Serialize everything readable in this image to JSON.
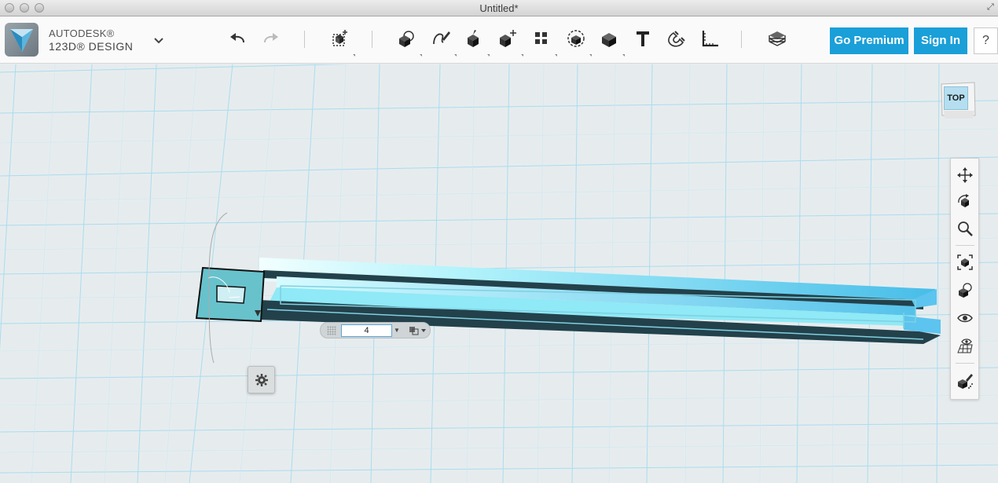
{
  "window": {
    "title": "Untitled*"
  },
  "brand": {
    "line1": "AUTODESK®",
    "line2": "123D® DESIGN"
  },
  "toolbar": {
    "buttons": [
      {
        "name": "undo-icon"
      },
      {
        "name": "redo-icon"
      },
      {
        "name": "transform-icon"
      },
      {
        "name": "primitives-icon"
      },
      {
        "name": "sketch-icon"
      },
      {
        "name": "construct-icon"
      },
      {
        "name": "modify-icon"
      },
      {
        "name": "pattern-icon"
      },
      {
        "name": "grouping-icon"
      },
      {
        "name": "combine-icon"
      },
      {
        "name": "text-icon"
      },
      {
        "name": "snap-icon"
      },
      {
        "name": "measure-icon"
      },
      {
        "name": "material-icon"
      }
    ],
    "go_premium_label": "Go Premium",
    "sign_in_label": "Sign In",
    "help_label": "?"
  },
  "viewcube": {
    "face_label": "TOP"
  },
  "navbar": {
    "buttons": [
      "pan-icon",
      "orbit-icon",
      "zoom-icon",
      "fit-icon",
      "view-mode-icon",
      "visibility-icon",
      "grid-visibility-icon",
      "material-preview-icon"
    ]
  },
  "inline_input": {
    "value": "4"
  },
  "colors": {
    "accent": "#1a9fd8",
    "grid_line": "#a9dcee",
    "shape_fill": "#5bc6ee",
    "shape_dark": "#23414b",
    "selection": "#7fd0e0"
  }
}
